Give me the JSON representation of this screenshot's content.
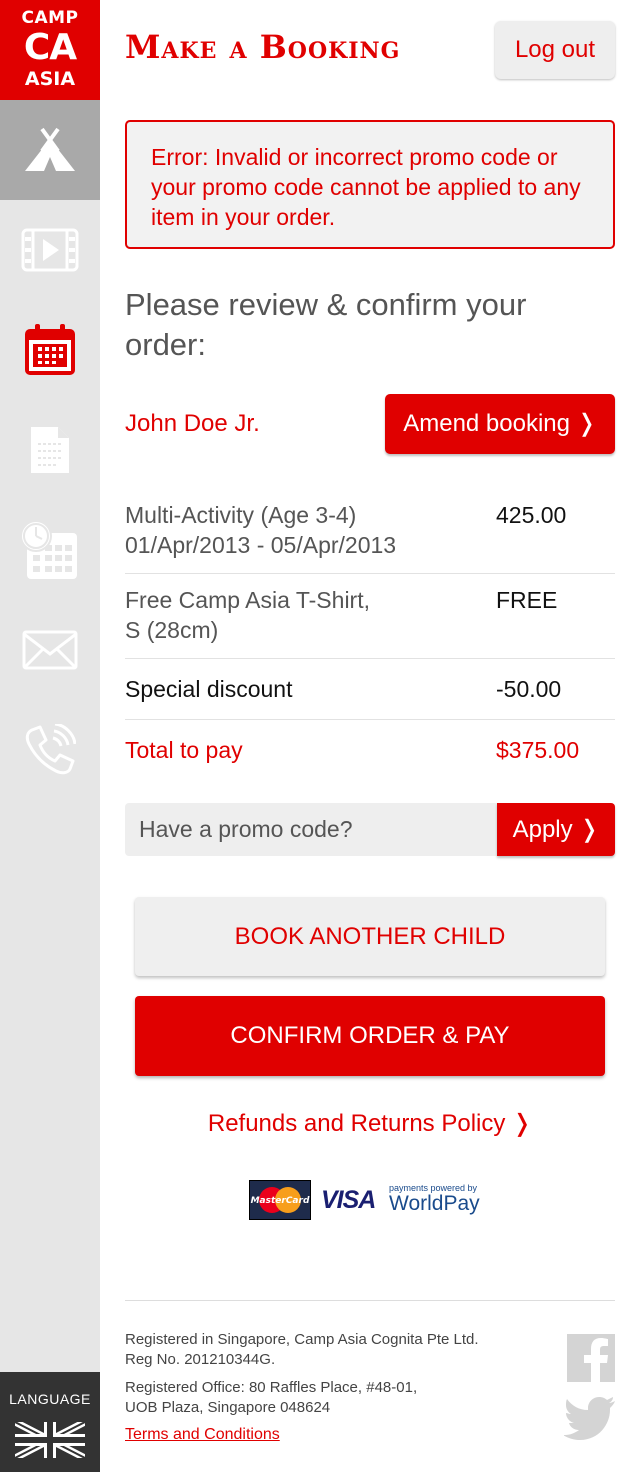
{
  "logo": {
    "line1": "CAMP",
    "line2": "CA",
    "line3": "ASIA"
  },
  "sidebar": {
    "items": [
      {
        "icon": "tent-icon",
        "active": true
      },
      {
        "icon": "video-icon",
        "active": false
      },
      {
        "icon": "calendar-icon",
        "active": false
      },
      {
        "icon": "document-icon",
        "active": false
      },
      {
        "icon": "schedule-icon",
        "active": false
      },
      {
        "icon": "mail-icon",
        "active": false
      },
      {
        "icon": "phone-icon",
        "active": false
      }
    ],
    "language_label": "LANGUAGE",
    "language_icon": "uk-flag-icon"
  },
  "header": {
    "title": "Make a Booking",
    "logout_label": "Log out"
  },
  "error": {
    "message": "Error: Invalid or incorrect promo code or your promo code cannot be applied to any item in your order."
  },
  "review": {
    "heading": "Please review & confirm your order:"
  },
  "child": {
    "name": "John Doe Jr.",
    "amend_label": "Amend booking ❭"
  },
  "order": {
    "items": [
      {
        "line1": "Multi-Activity (Age 3-4)",
        "line2": "01/Apr/2013 - 05/Apr/2013",
        "amount": "425.00"
      },
      {
        "line1": "Free Camp Asia T-Shirt,",
        "line2": "S (28cm)",
        "amount": "FREE"
      },
      {
        "line1": "Special discount",
        "line2": "",
        "amount": "-50.00"
      }
    ],
    "total_label": "Total to pay",
    "total_amount": "$375.00"
  },
  "promo": {
    "placeholder": "Have a promo code?",
    "value": "",
    "apply_label": "Apply ❭"
  },
  "actions": {
    "book_another_label": "BOOK ANOTHER CHILD",
    "confirm_label": "CONFIRM ORDER & PAY",
    "refunds_label": "Refunds and Returns Policy ❭"
  },
  "payment": {
    "mastercard_label": "MasterCard",
    "visa_label": "VISA",
    "worldpay_small": "payments powered by",
    "worldpay_label": "WorldPay"
  },
  "footer": {
    "line1": "Registered in Singapore, Camp Asia Cognita Pte Ltd.",
    "line2": "Reg No. 201210344G.",
    "line3": "Registered Office: 80 Raffles Place, #48-01,",
    "line4": "UOB Plaza, Singapore 048624",
    "terms_label": "Terms and Conditions",
    "social_icons": [
      "facebook-icon",
      "twitter-icon"
    ]
  },
  "colors": {
    "brand_red": "#e00000",
    "sidebar_bg": "#e6e6e6",
    "sidebar_active": "#a9a9a9",
    "language_bg": "#333333"
  }
}
